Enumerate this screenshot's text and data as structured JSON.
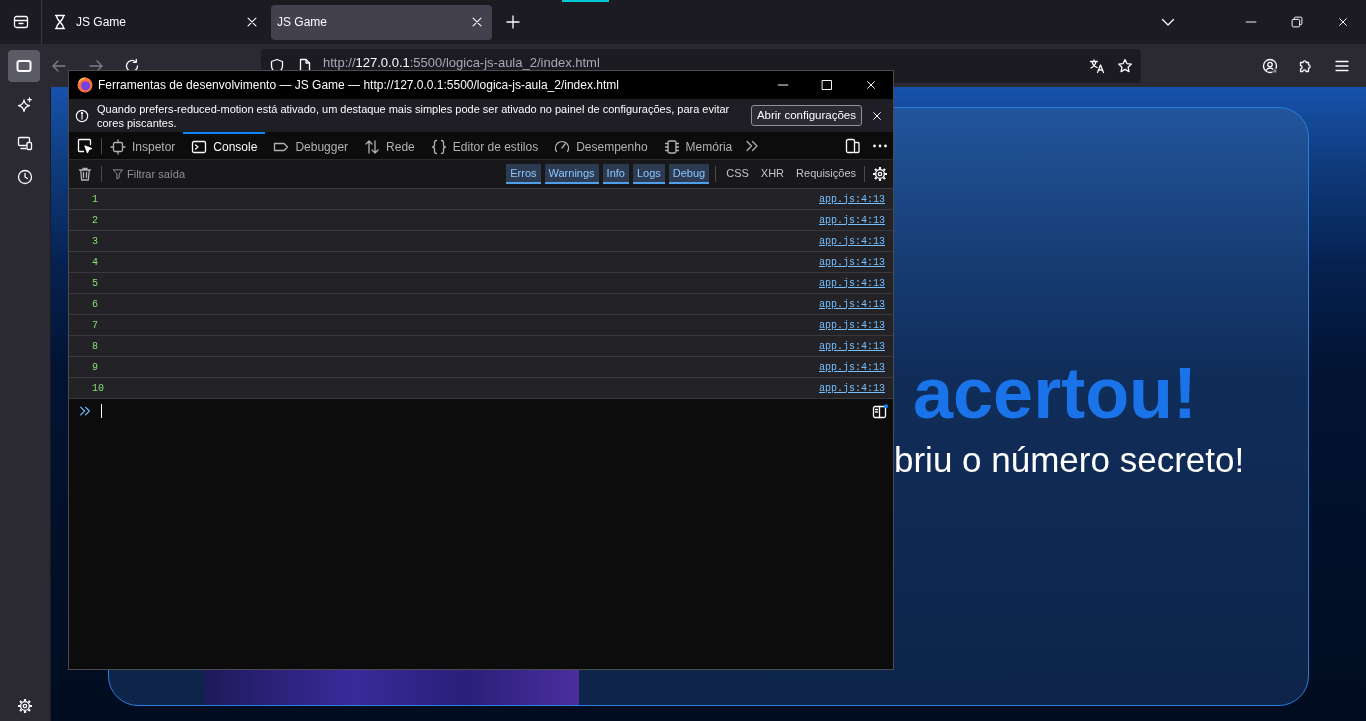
{
  "browser": {
    "tabs": [
      {
        "title": "JS Game",
        "kind": "iconed",
        "selected": false
      },
      {
        "title": "JS Game",
        "kind": "plain",
        "selected": true
      }
    ],
    "sidebar_toggle": {
      "selected": true
    },
    "nav_buttons": [
      {
        "kind": "back",
        "disabled": true
      },
      {
        "kind": "forward",
        "disabled": true
      },
      {
        "kind": "reload",
        "disabled": false
      }
    ],
    "url": {
      "scheme": "http://",
      "host": "127.0.0.1",
      "path": ":5500/logica-js-aula_2/index.html"
    }
  },
  "page": {
    "heading": "acertou!",
    "message": "briu o número secreto!"
  },
  "devtools": {
    "title": "Ferramentas de desenvolvimento — JS Game — http://127.0.0.1:5500/logica-js-aula_2/index.html",
    "notification": {
      "text": "Quando prefers-reduced-motion está ativado, um destaque mais simples pode ser ativado no painel de configurações, para evitar cores piscantes.",
      "button": "Abrir configurações"
    },
    "tools": [
      {
        "kind": "inspector",
        "label": "Inspetor",
        "selected": false
      },
      {
        "kind": "console",
        "label": "Console",
        "selected": true
      },
      {
        "kind": "debugger",
        "label": "Debugger",
        "selected": false
      },
      {
        "kind": "network",
        "label": "Rede",
        "selected": false
      },
      {
        "kind": "style",
        "label": "Editor de estilos",
        "selected": false
      },
      {
        "kind": "performance",
        "label": "Desempenho",
        "selected": false
      },
      {
        "kind": "memory",
        "label": "Memória",
        "selected": false
      }
    ],
    "filter": {
      "placeholder": "Filtrar saída"
    },
    "levels": [
      {
        "label": "Erros",
        "selected": true
      },
      {
        "label": "Warnings",
        "selected": true
      },
      {
        "label": "Info",
        "selected": true
      },
      {
        "label": "Logs",
        "selected": true
      },
      {
        "label": "Debug",
        "selected": true
      }
    ],
    "types": [
      {
        "label": "CSS",
        "selected": false
      },
      {
        "label": "XHR",
        "selected": false
      },
      {
        "label": "Requisições",
        "selected": false
      }
    ],
    "messages": [
      {
        "text": "1",
        "source": "app.js:4:13"
      },
      {
        "text": "2",
        "source": "app.js:4:13"
      },
      {
        "text": "3",
        "source": "app.js:4:13"
      },
      {
        "text": "4",
        "source": "app.js:4:13"
      },
      {
        "text": "5",
        "source": "app.js:4:13"
      },
      {
        "text": "6",
        "source": "app.js:4:13"
      },
      {
        "text": "7",
        "source": "app.js:4:13"
      },
      {
        "text": "8",
        "source": "app.js:4:13"
      },
      {
        "text": "9",
        "source": "app.js:4:13"
      },
      {
        "text": "10",
        "source": "app.js:4:13"
      }
    ]
  }
}
